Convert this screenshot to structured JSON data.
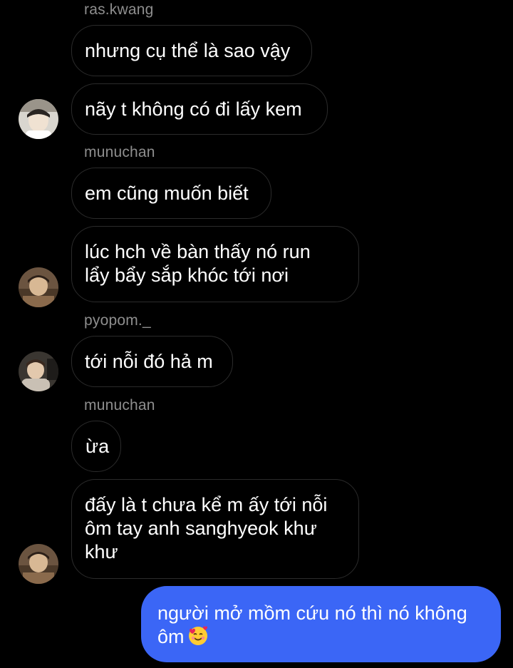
{
  "thread": {
    "messages": [
      {
        "sender": "ras.kwang",
        "lines": [
          "nhưng cụ thể là sao vậy"
        ]
      },
      {
        "lines": [
          "nãy t không có đi lấy kem"
        ]
      },
      {
        "sender": "munuchan",
        "lines": [
          "em cũng muốn biết"
        ]
      },
      {
        "lines": [
          "lúc hch về bàn thấy nó run",
          "lẩy bẩy sắp khóc tới nơi"
        ]
      },
      {
        "sender": "pyopom._",
        "lines": [
          "tới nỗi đó hả m"
        ]
      },
      {
        "sender": "munuchan",
        "lines": [
          "ừa"
        ]
      },
      {
        "lines": [
          "đấy là t chưa kể m ấy tới nỗi",
          "ôm tay anh sanghyeok khư",
          "khư"
        ]
      }
    ],
    "outgoing": {
      "lines": [
        "người mở mồm cứu nó thì nó không",
        "ôm"
      ],
      "emoji": "smiling-face-with-hearts"
    }
  },
  "colors": {
    "background": "#000000",
    "incoming_border": "#2b2b2b",
    "sender_name": "#8e8e8e",
    "outgoing_bubble": "#3b66f6"
  }
}
